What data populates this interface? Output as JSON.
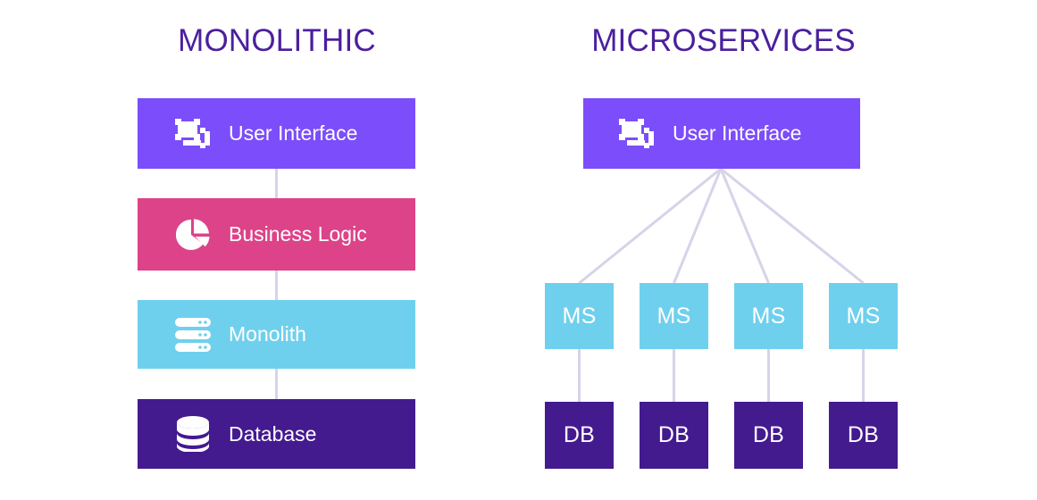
{
  "diagram": {
    "title_left": "MONOLITHIC",
    "title_right": "MICROSERVICES",
    "title_color": "#4b1f9e",
    "background": "#ffffff",
    "connector_color": "#d6d3ea"
  },
  "monolithic": {
    "layers": [
      {
        "label": "User Interface",
        "icon": "monitor-device-icon",
        "color": "#7c4dfa"
      },
      {
        "label": "Business Logic",
        "icon": "pie-chart-icon",
        "color": "#dd4389"
      },
      {
        "label": "Monolith",
        "icon": "server-stack-icon",
        "color": "#6fd0ed"
      },
      {
        "label": "Database",
        "icon": "database-icon",
        "color": "#441a8f"
      }
    ]
  },
  "microservices": {
    "ui": {
      "label": "User Interface",
      "icon": "monitor-device-icon",
      "color": "#7c4dfa"
    },
    "services": [
      {
        "label": "MS",
        "color": "#6fd0ed"
      },
      {
        "label": "MS",
        "color": "#6fd0ed"
      },
      {
        "label": "MS",
        "color": "#6fd0ed"
      },
      {
        "label": "MS",
        "color": "#6fd0ed"
      }
    ],
    "databases": [
      {
        "label": "DB",
        "color": "#441a8f"
      },
      {
        "label": "DB",
        "color": "#441a8f"
      },
      {
        "label": "DB",
        "color": "#441a8f"
      },
      {
        "label": "DB",
        "color": "#441a8f"
      }
    ]
  }
}
